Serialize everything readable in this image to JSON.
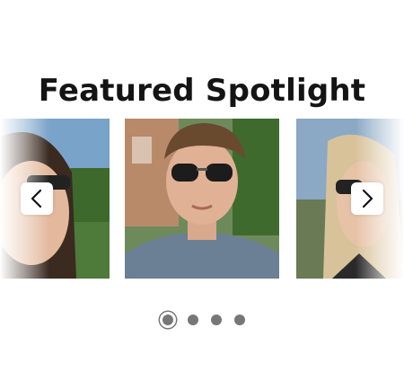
{
  "section": {
    "title": "Featured Spotlight"
  },
  "carousel": {
    "slides": [
      {
        "name": "woman-left",
        "state": "partial"
      },
      {
        "name": "man-sunglasses",
        "state": "active"
      },
      {
        "name": "woman-right",
        "state": "partial"
      }
    ],
    "prev_icon": "chevron-left-icon",
    "next_icon": "chevron-right-icon",
    "dots_count": 4,
    "active_dot_index": 0
  },
  "colors": {
    "title": "#141414",
    "dot": "#777777",
    "arrow_bg": "#ffffff"
  }
}
